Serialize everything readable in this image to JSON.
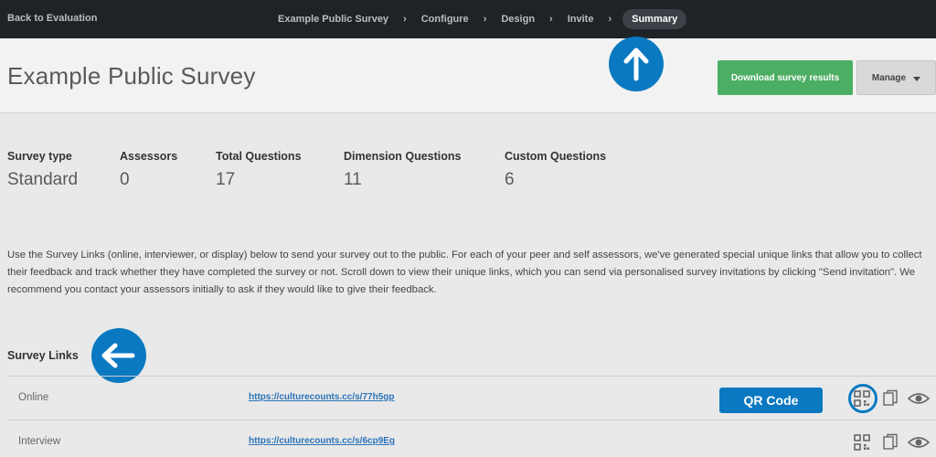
{
  "topbar": {
    "back_label": "Back to Evaluation",
    "crumbs": [
      {
        "label": "Example Public Survey"
      },
      {
        "label": "Configure"
      },
      {
        "label": "Design"
      },
      {
        "label": "Invite"
      },
      {
        "label": "Summary"
      }
    ],
    "active_crumb": "Summary",
    "separator": "›"
  },
  "header": {
    "title": "Example Public Survey",
    "download_label": "Download survey results",
    "manage_label": "Manage"
  },
  "stats": [
    {
      "label": "Survey type",
      "value": "Standard"
    },
    {
      "label": "Assessors",
      "value": "0"
    },
    {
      "label": "Total Questions",
      "value": "17"
    },
    {
      "label": "Dimension Questions",
      "value": "11"
    },
    {
      "label": "Custom Questions",
      "value": "6"
    }
  ],
  "description": "Use the Survey Links (online, interviewer, or display) below to send your survey out to the public. For each of your peer and self assessors, we've generated special unique links that allow you to collect their feedback and track whether they have completed the survey or not. Scroll down to view their unique links, which you can send via personalised survey invitations by clicking \"Send invitation\". We recommend you contact your assessors initially to ask if they would like to give their feedback.",
  "survey_links": {
    "title": "Survey Links",
    "rows": [
      {
        "label": "Online",
        "url": "https://culturecounts.cc/s/77h5gp"
      },
      {
        "label": "Interview",
        "url": "https://culturecounts.cc/s/6cp9Eg"
      }
    ],
    "qr_label": "QR Code"
  },
  "colors": {
    "topbar": "#1f2326",
    "accent_blue": "#0b79c2",
    "download_green": "#4cae63",
    "link_blue": "#2a73b8"
  },
  "icons": {
    "annotation_up": "arrow-up-icon",
    "annotation_left": "arrow-left-icon",
    "qr": "qr-code-icon",
    "copy": "copy-icon",
    "preview": "eye-icon"
  }
}
